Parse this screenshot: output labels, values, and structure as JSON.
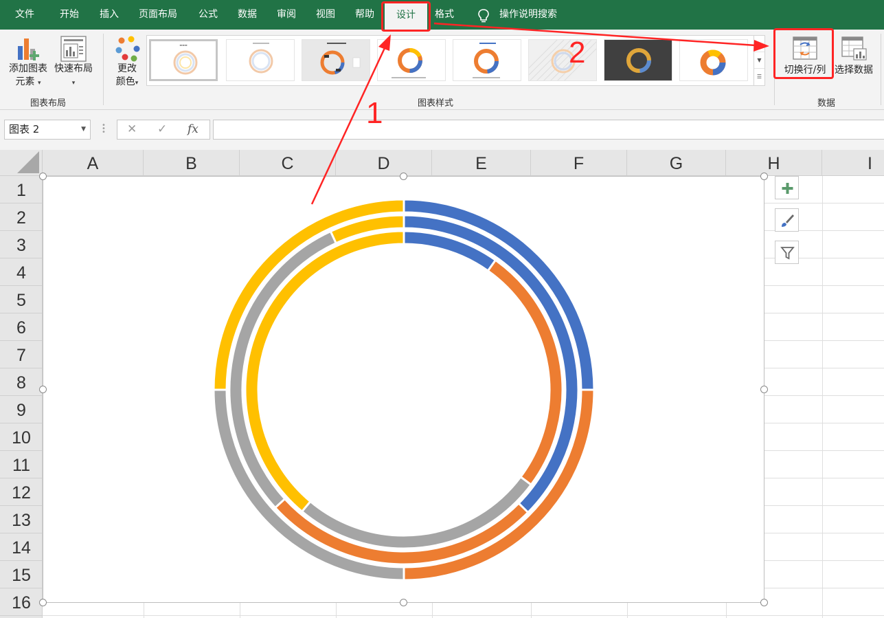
{
  "menu": {
    "tabs": [
      "文件",
      "开始",
      "插入",
      "页面布局",
      "公式",
      "数据",
      "审阅",
      "视图",
      "帮助",
      "设计",
      "格式"
    ],
    "active_tab": "设计",
    "tell_me": "操作说明搜索"
  },
  "ribbon": {
    "add_element_l1": "添加图表",
    "add_element_l2": "元素",
    "quick_layout": "快速布局",
    "change_color_l1": "更改",
    "change_color_l2": "颜色",
    "group_layouts": "图表布局",
    "group_styles": "图表样式",
    "switch_row_col": "切换行/列",
    "select_data": "选择数据",
    "group_data": "数据"
  },
  "formula_bar": {
    "name_box": "图表 2",
    "cancel_glyph": "✕",
    "enter_glyph": "✓",
    "fx": "fx"
  },
  "grid": {
    "columns": [
      "A",
      "B",
      "C",
      "D",
      "E",
      "F",
      "G",
      "H",
      "I"
    ],
    "rows": [
      "1",
      "2",
      "3",
      "4",
      "5",
      "6",
      "7",
      "8",
      "9",
      "10",
      "11",
      "12",
      "13",
      "14",
      "15",
      "16"
    ]
  },
  "chart": {
    "side_buttons": [
      "plus-icon",
      "brush-icon",
      "filter-icon"
    ],
    "colors": {
      "blue": "#4472C4",
      "orange": "#ED7D31",
      "gray": "#A5A5A5",
      "yellow": "#FFC000"
    }
  },
  "chart_data": {
    "type": "doughnut",
    "rings": [
      {
        "ring": "outer",
        "values": [
          25,
          25,
          25,
          25
        ],
        "colors": [
          "#4472C4",
          "#ED7D31",
          "#A5A5A5",
          "#FFC000"
        ]
      },
      {
        "ring": "middle",
        "values": [
          37.4,
          25.8,
          29.9,
          6.9
        ],
        "colors": [
          "#4472C4",
          "#ED7D31",
          "#A5A5A5",
          "#FFC000"
        ]
      },
      {
        "ring": "inner",
        "values": [
          9.8,
          25.4,
          25.9,
          38.9
        ],
        "colors": [
          "#4472C4",
          "#ED7D31",
          "#A5A5A5",
          "#FFC000"
        ]
      }
    ],
    "title": "",
    "legend": "none"
  },
  "annotations": {
    "step1": "1",
    "step2": "2",
    "color": "#FF2424"
  }
}
